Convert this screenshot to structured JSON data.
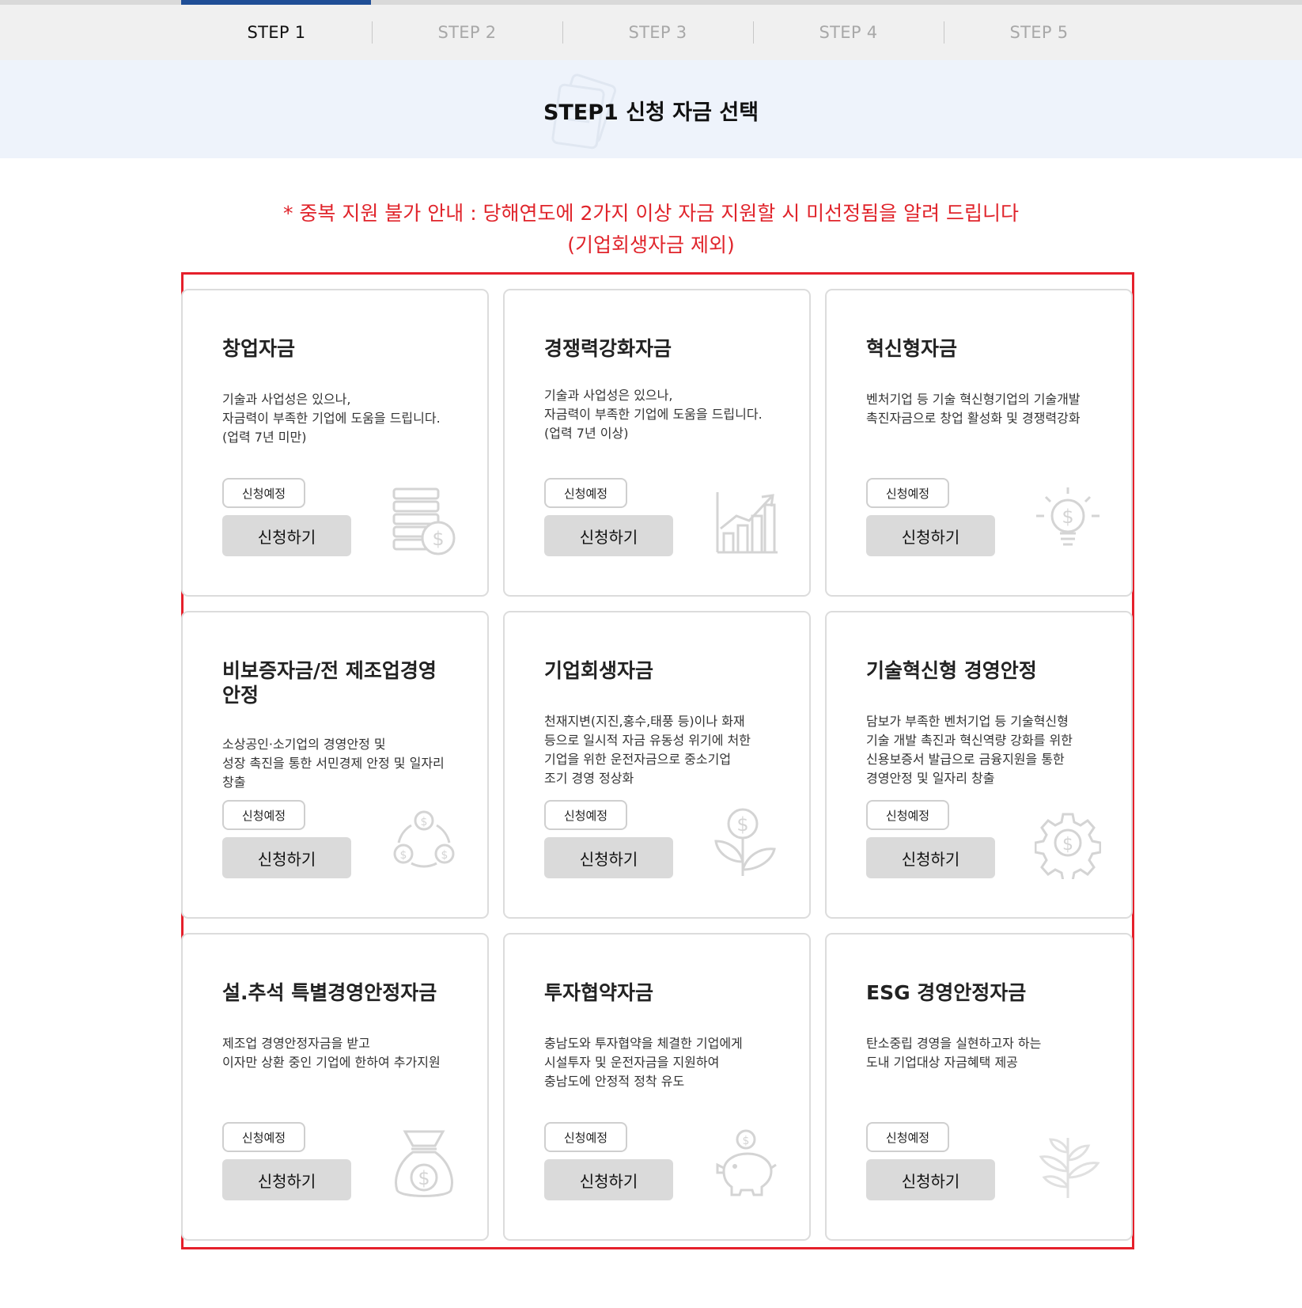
{
  "steps": [
    {
      "label": "STEP 1",
      "active": true
    },
    {
      "label": "STEP 2",
      "active": false
    },
    {
      "label": "STEP 3",
      "active": false
    },
    {
      "label": "STEP 4",
      "active": false
    },
    {
      "label": "STEP 5",
      "active": false
    }
  ],
  "page_title": "STEP1 신청 자금 선택",
  "notice": {
    "line1": "* 중복 지원 불가 안내 : 당해연도에 2가지 이상 자금 지원할 시 미선정됨을 알려 드립니다",
    "line2": "(기업회생자금 제외)"
  },
  "colors": {
    "accent": "#1f4e96",
    "notice": "#e0242b",
    "highlight_frame": "#e5202b",
    "button_bg": "#dadada"
  },
  "cards": [
    {
      "title": "창업자금",
      "desc": "기술과 사업성은 있으나,\n자금력이 부족한 기업에 도움을 드립니다.\n(업력 7년 미만)",
      "badge": "신청예정",
      "button": "신청하기",
      "icon": "coins-stack-icon"
    },
    {
      "title": "경쟁력강화자금",
      "desc": "기술과 사업성은 있으나,\n자금력이 부족한 기업에 도움을 드립니다.\n(업력 7년 이상)",
      "badge": "신청예정",
      "button": "신청하기",
      "icon": "growth-chart-icon"
    },
    {
      "title": "혁신형자금",
      "desc": "벤처기업 등 기술 혁신형기업의 기술개발\n촉진자금으로 창업 활성화 및 경쟁력강화",
      "badge": "신청예정",
      "button": "신청하기",
      "icon": "lightbulb-dollar-icon"
    },
    {
      "title": "비보증자금/전 제조업경영안정",
      "desc": "소상공인·소기업의 경영안정 및\n성장 촉진을 통한 서민경제 안정 및 일자리\n창출",
      "badge": "신청예정",
      "button": "신청하기",
      "icon": "coins-cycle-icon"
    },
    {
      "title": "기업회생자금",
      "desc": "천재지변(지진,홍수,태풍 등)이나 화재\n등으로 일시적 자금 유동성 위기에 처한\n기업을 위한 운전자금으로 중소기업\n조기 경영 정상화",
      "badge": "신청예정",
      "button": "신청하기",
      "icon": "money-plant-icon"
    },
    {
      "title": "기술혁신형 경영안정",
      "desc": "담보가 부족한 벤처기업 등 기술혁신형\n기술 개발 촉진과 혁신역량 강화를 위한\n신용보증서 발급으로 금융지원을 통한\n경영안정 및 일자리 창출",
      "badge": "신청예정",
      "button": "신청하기",
      "icon": "gear-dollar-icon"
    },
    {
      "title": "설.추석 특별경영안정자금",
      "desc": "제조업 경영안정자금을 받고\n이자만 상환 중인 기업에 한하여 추가지원",
      "badge": "신청예정",
      "button": "신청하기",
      "icon": "money-bag-icon"
    },
    {
      "title": "투자협약자금",
      "desc": "충남도와 투자협약을 체결한 기업에게\n시설투자 및 운전자금을 지원하여\n충남도에 안정적 정착 유도",
      "badge": "신청예정",
      "button": "신청하기",
      "icon": "piggy-bank-icon"
    },
    {
      "title": "ESG 경영안정자금",
      "desc": "탄소중립 경영을 실현하고자 하는\n도내 기업대상 자금혜택 제공",
      "badge": "신청예정",
      "button": "신청하기",
      "icon": "leaf-branch-icon"
    }
  ]
}
